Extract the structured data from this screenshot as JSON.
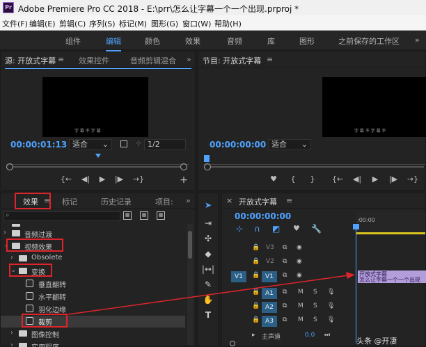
{
  "app": {
    "title": "Adobe Premiere Pro CC 2018 - E:\\prr\\怎么让字幕一个一个出现.prproj *",
    "logo_text": "Pr"
  },
  "menu": [
    "文件(F)",
    "编辑(E)",
    "剪辑(C)",
    "序列(S)",
    "标记(M)",
    "图形(G)",
    "窗口(W)",
    "帮助(H)"
  ],
  "workspaces": {
    "items": [
      "组件",
      "编辑",
      "颜色",
      "效果",
      "音频",
      "库",
      "图形",
      "之前保存的工作区"
    ],
    "active": "编辑",
    "more": "»"
  },
  "source_panel": {
    "tabs": [
      "源: 开放式字幕",
      "效果控件",
      "音频剪辑混合"
    ],
    "menu_icon": "≡",
    "more": "»",
    "video_text": "字 幕 不 字 幕",
    "timecode": "00:00:01:13",
    "fit": "适合",
    "resolution": "1/2",
    "controls": [
      "{←",
      "◀|",
      "▶",
      "|▶",
      "→}",
      "+"
    ]
  },
  "program_panel": {
    "tab": "节目: 开放式字幕",
    "menu_icon": "≡",
    "video_text": "字 幕 不 字 幕 不",
    "timecode": "00:00:00:00",
    "fit": "适合",
    "controls": [
      "♥",
      "{",
      "}",
      "{←",
      "◀|",
      "▶",
      "|▶",
      "→}"
    ]
  },
  "effects_panel": {
    "tabs": [
      "效果",
      "标记",
      "历史记录",
      "项目:"
    ],
    "menu_icon": "≡",
    "more": "»",
    "search_placeholder": "",
    "tree": [
      {
        "label": "音频过渡",
        "level": 0,
        "kind": "folder",
        "expanded": false
      },
      {
        "label": "视频效果",
        "level": 0,
        "kind": "folder",
        "expanded": true
      },
      {
        "label": "Obsolete",
        "level": 1,
        "kind": "folder",
        "expanded": false
      },
      {
        "label": "变换",
        "level": 1,
        "kind": "folder",
        "expanded": true
      },
      {
        "label": "垂直翻转",
        "level": 2,
        "kind": "effect"
      },
      {
        "label": "水平翻转",
        "level": 2,
        "kind": "effect"
      },
      {
        "label": "羽化边缘",
        "level": 2,
        "kind": "effect"
      },
      {
        "label": "裁剪",
        "level": 2,
        "kind": "effect",
        "selected": true
      },
      {
        "label": "图像控制",
        "level": 1,
        "kind": "folder",
        "expanded": false
      },
      {
        "label": "实用程序",
        "level": 1,
        "kind": "folder",
        "expanded": false
      }
    ]
  },
  "timeline": {
    "sequence_tab": "开放式字幕",
    "menu_icon": "≡",
    "timecode": "00:00:00:00",
    "ruler_start": ":00:00",
    "tracks": [
      {
        "src": "",
        "name": "V3",
        "kind": "video"
      },
      {
        "src": "",
        "name": "V2",
        "kind": "video"
      },
      {
        "src": "V1",
        "name": "V1",
        "kind": "video",
        "clip": "开放式字幕",
        "clip_sub": "怎么让字幕一个一个出现"
      },
      {
        "src": "",
        "name": "A1",
        "kind": "audio"
      },
      {
        "src": "",
        "name": "A2",
        "kind": "audio"
      },
      {
        "src": "",
        "name": "A3",
        "kind": "audio"
      }
    ],
    "master_label": "主声道",
    "master_value": "0.0",
    "audio_toggles": [
      "M",
      "S"
    ]
  },
  "watermark": "头条 @开凄",
  "colors": {
    "accent": "#4fa3ff",
    "highlight": "#e0242b",
    "clip": "#b39ddb"
  }
}
